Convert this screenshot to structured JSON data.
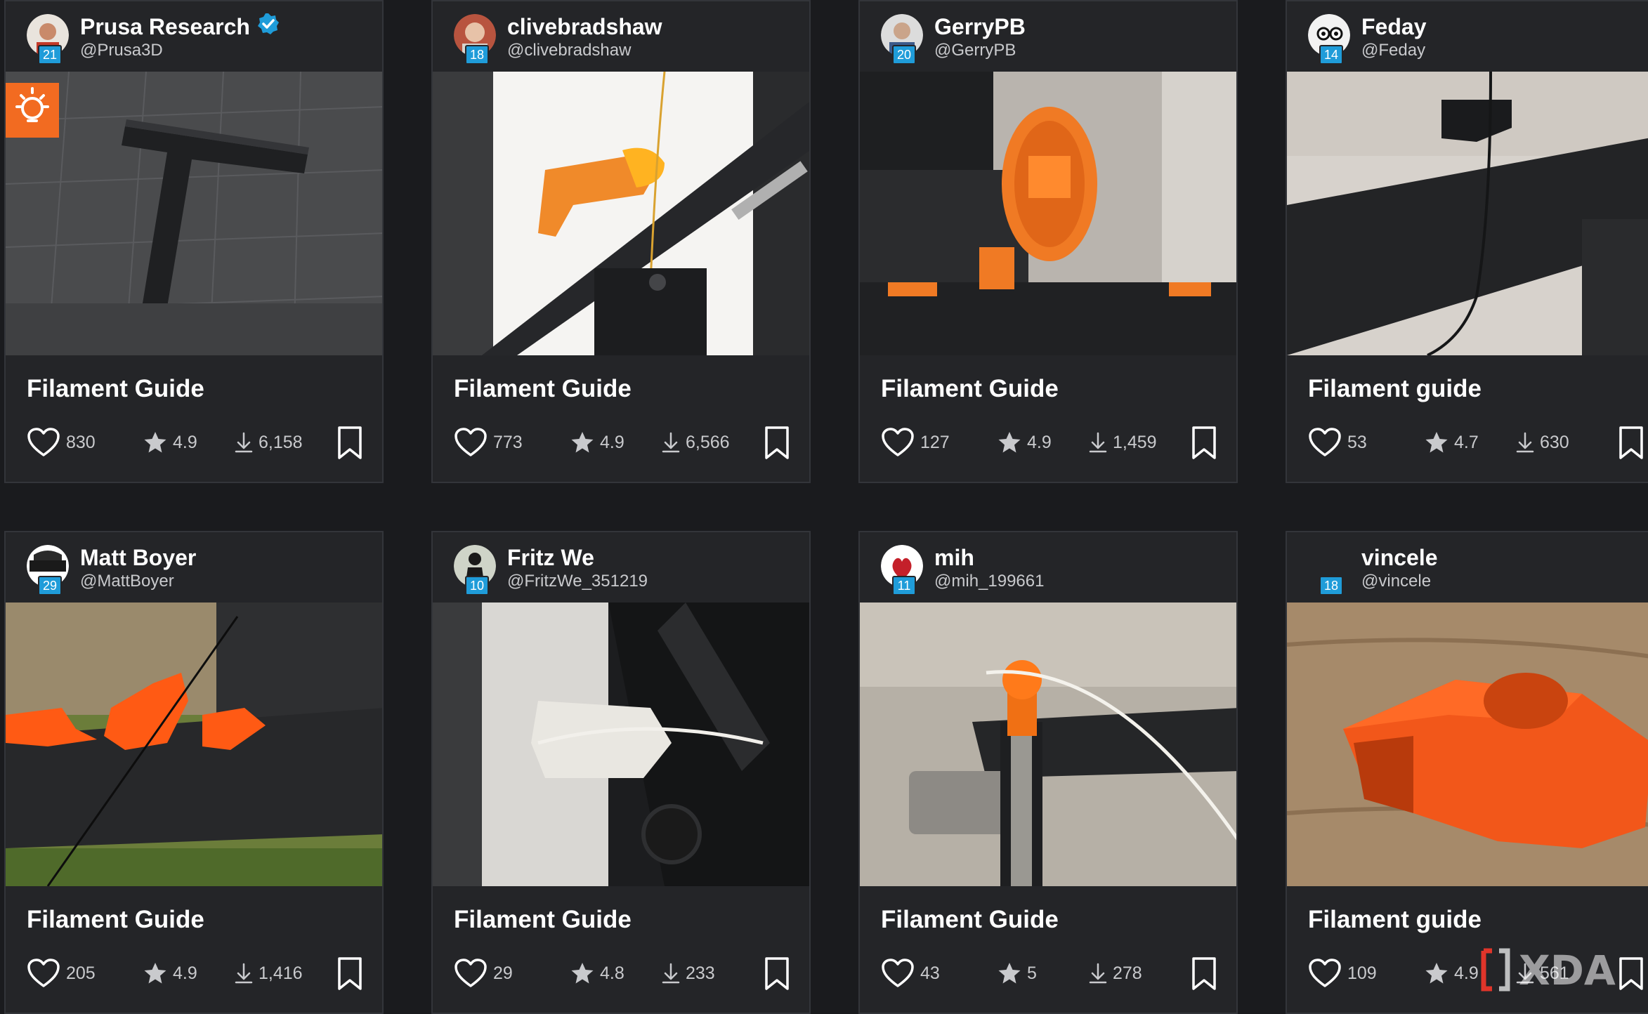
{
  "cards": [
    {
      "user_name": "Prusa Research",
      "handle": "@Prusa3D",
      "level": "21",
      "verified": true,
      "title": "Filament Guide",
      "likes": "830",
      "rating": "4.9",
      "downloads": "6,158"
    },
    {
      "user_name": "clivebradshaw",
      "handle": "@clivebradshaw",
      "level": "18",
      "verified": false,
      "title": "Filament Guide",
      "likes": "773",
      "rating": "4.9",
      "downloads": "6,566"
    },
    {
      "user_name": "GerryPB",
      "handle": "@GerryPB",
      "level": "20",
      "verified": false,
      "title": "Filament Guide",
      "likes": "127",
      "rating": "4.9",
      "downloads": "1,459"
    },
    {
      "user_name": "Feday",
      "handle": "@Feday",
      "level": "14",
      "verified": false,
      "title": "Filament guide",
      "likes": "53",
      "rating": "4.7",
      "downloads": "630"
    },
    {
      "user_name": "Matt Boyer",
      "handle": "@MattBoyer",
      "level": "29",
      "verified": false,
      "title": "Filament Guide",
      "likes": "205",
      "rating": "4.9",
      "downloads": "1,416"
    },
    {
      "user_name": "Fritz We",
      "handle": "@FritzWe_351219",
      "level": "10",
      "verified": false,
      "title": "Filament Guide",
      "likes": "29",
      "rating": "4.8",
      "downloads": "233"
    },
    {
      "user_name": "mih",
      "handle": "@mih_199661",
      "level": "11",
      "verified": false,
      "title": "Filament Guide",
      "likes": "43",
      "rating": "5",
      "downloads": "278"
    },
    {
      "user_name": "vincele",
      "handle": "@vincele",
      "level": "18",
      "verified": false,
      "title": "Filament guide",
      "likes": "109",
      "rating": "4.9",
      "downloads": "561"
    }
  ],
  "icons": {
    "like": "heart-icon",
    "rating": "star-icon",
    "downloads": "download-icon",
    "bookmark": "bookmark-icon",
    "verified": "verified-check-icon",
    "tip": "lightbulb-icon"
  },
  "colors": {
    "background": "#1a1b1e",
    "card": "#242528",
    "accent_orange": "#f26b21",
    "level_badge": "#1f9cd9",
    "verified": "#1f9cd9"
  },
  "watermark": "XDA"
}
